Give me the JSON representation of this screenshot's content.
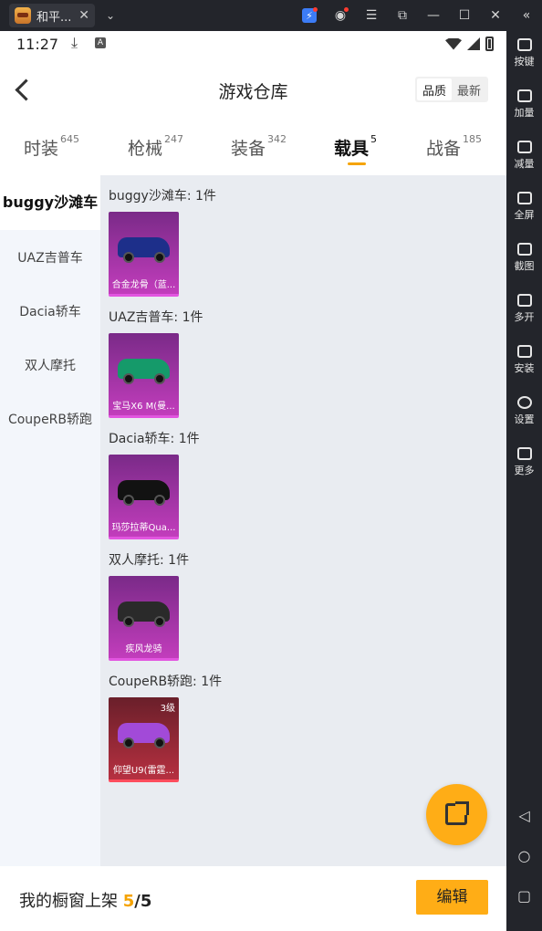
{
  "window": {
    "tab_title": "和平...",
    "close_glyph": "✕",
    "dropdown_glyph": "⌄"
  },
  "side_toolbar": [
    {
      "label": "按键",
      "icon": "keyboard-icon"
    },
    {
      "label": "加量",
      "icon": "volume-up-icon"
    },
    {
      "label": "减量",
      "icon": "volume-down-icon"
    },
    {
      "label": "全屏",
      "icon": "fullscreen-icon"
    },
    {
      "label": "截图",
      "icon": "scissors-icon"
    },
    {
      "label": "多开",
      "icon": "multi-instance-icon"
    },
    {
      "label": "安装",
      "icon": "apk-install-icon"
    },
    {
      "label": "设置",
      "icon": "settings-icon"
    },
    {
      "label": "更多",
      "icon": "more-icon"
    }
  ],
  "status_bar": {
    "time": "11:27"
  },
  "header": {
    "title": "游戏仓库",
    "sort_options": [
      "品质",
      "最新"
    ],
    "sort_selected": "品质"
  },
  "tabs": [
    {
      "label": "时装",
      "count": "645"
    },
    {
      "label": "枪械",
      "count": "247"
    },
    {
      "label": "装备",
      "count": "342"
    },
    {
      "label": "载具",
      "count": "5",
      "active": true
    },
    {
      "label": "战备",
      "count": "185"
    }
  ],
  "categories": [
    {
      "label": "buggy沙滩车",
      "active": true
    },
    {
      "label": "UAZ吉普车"
    },
    {
      "label": "Dacia轿车"
    },
    {
      "label": "双人摩托"
    },
    {
      "label": "CoupeRB轿跑"
    }
  ],
  "groups": [
    {
      "title": "buggy沙滩车: 1件",
      "item": {
        "name": "合金龙骨（蓝...",
        "color": "#1d2f8a"
      }
    },
    {
      "title": "UAZ吉普车: 1件",
      "item": {
        "name": "宝马X6 M(曼...",
        "color": "#159a6a"
      }
    },
    {
      "title": "Dacia轿车: 1件",
      "item": {
        "name": "玛莎拉蒂Qua...",
        "color": "#121212"
      }
    },
    {
      "title": "双人摩托: 1件",
      "item": {
        "name": "疾风龙骑",
        "color": "#2a2a2a"
      }
    },
    {
      "title": "CoupeRB轿跑: 1件",
      "item": {
        "name": "仰望U9(雷霆...",
        "color": "#a24ad8",
        "level": "3级"
      }
    }
  ],
  "bottom": {
    "label": "我的橱窗上架 ",
    "count": "5",
    "total": "/5",
    "edit_label": "编辑"
  }
}
